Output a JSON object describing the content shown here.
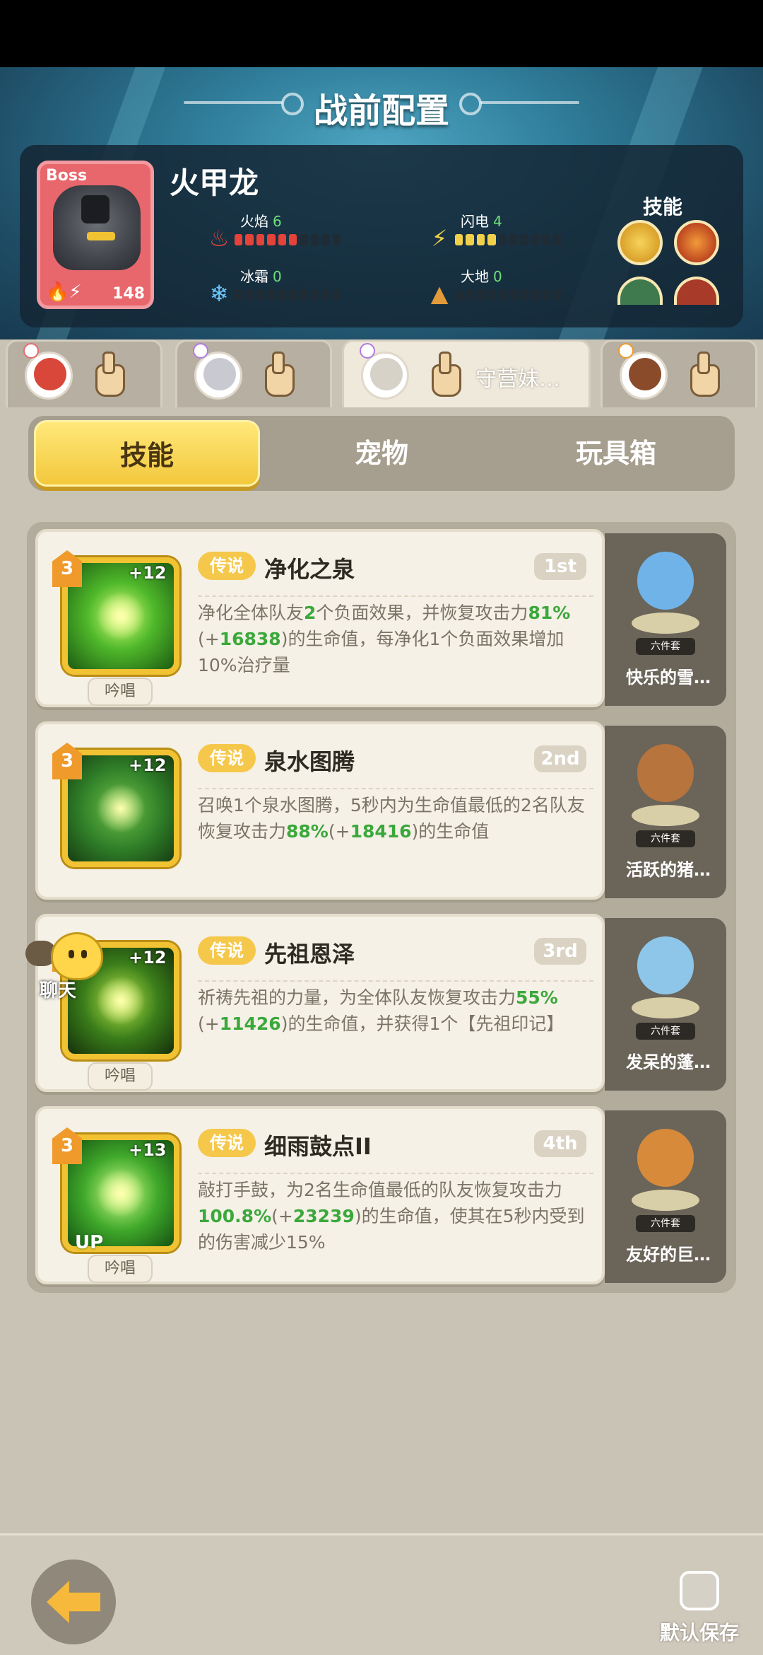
{
  "header": {
    "title": "战前配置"
  },
  "boss": {
    "tag": "Boss",
    "name": "火甲龙",
    "level": "148",
    "skills_label": "技能",
    "stats": [
      {
        "label": "火焰",
        "value": "6",
        "fill": 6,
        "max": 10,
        "color": "#e5423a",
        "icon": "fire-icon"
      },
      {
        "label": "闪电",
        "value": "4",
        "fill": 4,
        "max": 10,
        "color": "#f2d14a",
        "icon": "lightning-icon"
      },
      {
        "label": "冰霜",
        "value": "0",
        "fill": 0,
        "max": 10,
        "color": "#6fc6ff",
        "icon": "snowflake-icon"
      },
      {
        "label": "大地",
        "value": "0",
        "fill": 0,
        "max": 10,
        "color": "#e39a3b",
        "icon": "mountain-icon"
      }
    ]
  },
  "hero_tabs": [
    {
      "name": "",
      "active": false
    },
    {
      "name": "",
      "active": false
    },
    {
      "name": "守营妹…",
      "active": true
    },
    {
      "name": "",
      "active": false
    }
  ],
  "category_tabs": [
    {
      "label": "技能",
      "active": true
    },
    {
      "label": "宠物",
      "active": false
    },
    {
      "label": "玩具箱",
      "active": false
    }
  ],
  "skills": [
    {
      "rank": "3",
      "plus": "+12",
      "quality": "传说",
      "name": "净化之泉",
      "order": "1st",
      "tag": "吟唱",
      "up": "",
      "desc": [
        {
          "t": "净化全体队友"
        },
        {
          "t": "2",
          "n": true
        },
        {
          "t": "个负面效果，并恢复攻击力"
        },
        {
          "t": "81%",
          "n": true
        },
        {
          "t": "(+"
        },
        {
          "t": "16838",
          "n": true
        },
        {
          "t": ")的生命值，每净化1个负面效果增加10%治疗量"
        }
      ],
      "pet": {
        "name": "快乐的雪…",
        "set": "六件套"
      }
    },
    {
      "rank": "3",
      "plus": "+12",
      "quality": "传说",
      "name": "泉水图腾",
      "order": "2nd",
      "tag": "",
      "up": "",
      "desc": [
        {
          "t": "召唤1个泉水图腾，5秒内为生命值最低的2名队友恢复攻击力"
        },
        {
          "t": "88%",
          "n": true
        },
        {
          "t": "(+"
        },
        {
          "t": "18416",
          "n": true
        },
        {
          "t": ")的生命值"
        }
      ],
      "pet": {
        "name": "活跃的猪…",
        "set": "六件套"
      }
    },
    {
      "rank": "3",
      "plus": "+12",
      "quality": "传说",
      "name": "先祖恩泽",
      "order": "3rd",
      "tag": "吟唱",
      "up": "",
      "desc": [
        {
          "t": "祈祷先祖的力量，为全体队友恢复攻击力"
        },
        {
          "t": "55%",
          "n": true
        },
        {
          "t": "(+"
        },
        {
          "t": "11426",
          "n": true
        },
        {
          "t": ")的生命值，并获得1个【先祖印记】"
        }
      ],
      "pet": {
        "name": "发呆的蓬…",
        "set": "六件套"
      }
    },
    {
      "rank": "3",
      "plus": "+13",
      "quality": "传说",
      "name": "细雨鼓点II",
      "order": "4th",
      "tag": "吟唱",
      "up": "UP",
      "desc": [
        {
          "t": "敲打手鼓，为2名生命值最低的队友恢复攻击力"
        },
        {
          "t": "100.8%",
          "n": true
        },
        {
          "t": "(+"
        },
        {
          "t": "23239",
          "n": true
        },
        {
          "t": ")的生命值，使其在5秒内受到的伤害减少15%"
        }
      ],
      "pet": {
        "name": "友好的巨…",
        "set": "六件套"
      }
    }
  ],
  "chat": {
    "label": "聊天"
  },
  "footer": {
    "save_label": "默认保存"
  },
  "colors": {
    "accent_yellow": "#f3c83c",
    "panel": "#f5f1e7",
    "heal_green": "#3ba83b"
  }
}
